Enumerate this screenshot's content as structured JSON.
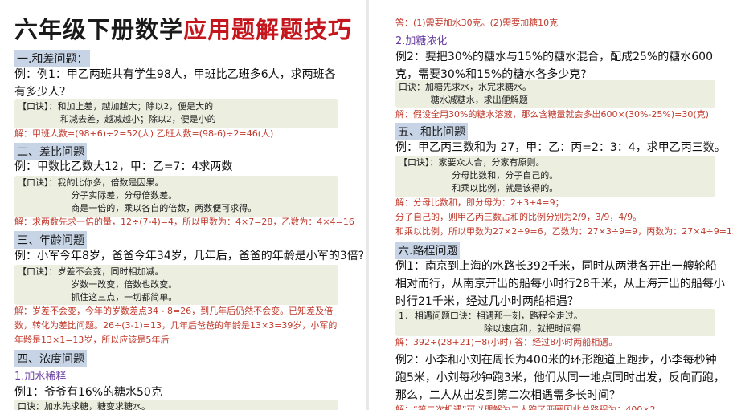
{
  "title": {
    "part1": "六年级下册数学",
    "part2": "应用题解题技巧"
  },
  "left": {
    "s1_head": "一.和差问题：",
    "s1_ex": "例：例1：甲乙两班共有学生98人，甲班比乙班多6人，求两班各有多少人？",
    "s1_note": "【口诀】：和加上差，越加越大；除以2，便是大的\n        和减去差，越减越小；除以2，便是小的",
    "s1_jie": "解：甲班人数=(98+6)÷2=52(人)        乙班人数=(98-6)÷2=46(人)",
    "s2_head": "二、差比问题",
    "s2_ex": "例：甲数比乙数大12，甲：乙=7：4求两数",
    "s2_note": "【口诀】：我的比你多，倍数是因果。\n          分子实际差，分母倍数差。\n          商是一倍的，乘以各自的倍数，两数便可求得。",
    "s2_jie": "解：求两数先求一倍的量，12÷(7-4)=4，所以甲数为：4×7=28，乙数为：4×4=16",
    "s3_head": "三、年龄问题",
    "s3_ex": "例：小军今年8岁，爸爸今年34岁，几年后，爸爸的年龄是小军的3倍?",
    "s3_note": "【口诀】：岁差不会变，同时相加减。\n          岁数一改变，倍数也改变。\n          抓住这三点，一切都简单。",
    "s3_jie": "解：岁差不会变，今年的岁数差点34 - 8=26，到几年后仍然不会变。已知差及倍数，转化为差比问题。26÷(3-1)=13，几年后爸爸的年龄是13×3=39岁，小军的年龄是13×1=13岁，所以应该是5年后",
    "s4_head": "四、浓度问题",
    "s4_sub": "1.加水稀释",
    "s4_ex": "例1：爷爷有16%的糖水50克",
    "s4_note": "口诀：加水先求糖，糖变求糖水。"
  },
  "right": {
    "top_ans": "答：(1)需要加水30克。(2)需要加糖10克",
    "r_sub": "2.加糖浓化",
    "r_ex2": "例2：要把30%的糖水与15%的糖水混合，配成25%的糖水600克，需要30%和15%的糖水各多少克?",
    "r_note": "口诀：加糖先求水，水完求糖水。\n      糖水减糖水，求出便解题",
    "r_jie": "解：假设全用30%的糖水溶液，那么含糖量就会多出600×(30%-25%)=30(克)",
    "s5_head": "五、和比问题",
    "s5_ex": "例：甲乙丙三数和为 27，甲：乙：丙=2：3：4，求甲乙丙三数。",
    "s5_note": "【口诀】：家要众人合，分家有原则。\n          分母比数和，分子自己的。\n          和乘以比例，就是该得的。",
    "s5_jie": "解：分母比数和，即分母为：2+3+4=9；\n分子自己的，则甲乙丙三数占和的比例分别为2/9，3/9，4/9。\n和乘以比例，所以甲数为27×2÷9=6，乙数为：27×3÷9=9，丙数为：27×4÷9=12",
    "s6_head": "六.路程问题",
    "s6_ex": "例1：南京到上海的水路长392千米，同时从两港各开出一艘轮船相对而行，从南京开出的船每小时行28千米，从上海开出的船每小时行21千米，经过几小时两船相遇？",
    "s6_note": "1. 相遇问题口诀：相遇那一刻，路程全走过。\n                除以速度和，就把时间得",
    "s6_jie": "解：392÷(28+21)=8(小时)  答：经过8小时两船相遇。",
    "s6_ex2": "例2：小李和小刘在周长为400米的环形跑道上跑步，小李每秒钟跑5米，小刘每秒钟跑3米，他们从同一地点同时出发，反向而跑，那么，二人从出发到第二次相遇需多长时间？",
    "s6_jie2": "解：“第二次相遇”可以理解为二人跑了两圈因此总路程为：400×2"
  }
}
